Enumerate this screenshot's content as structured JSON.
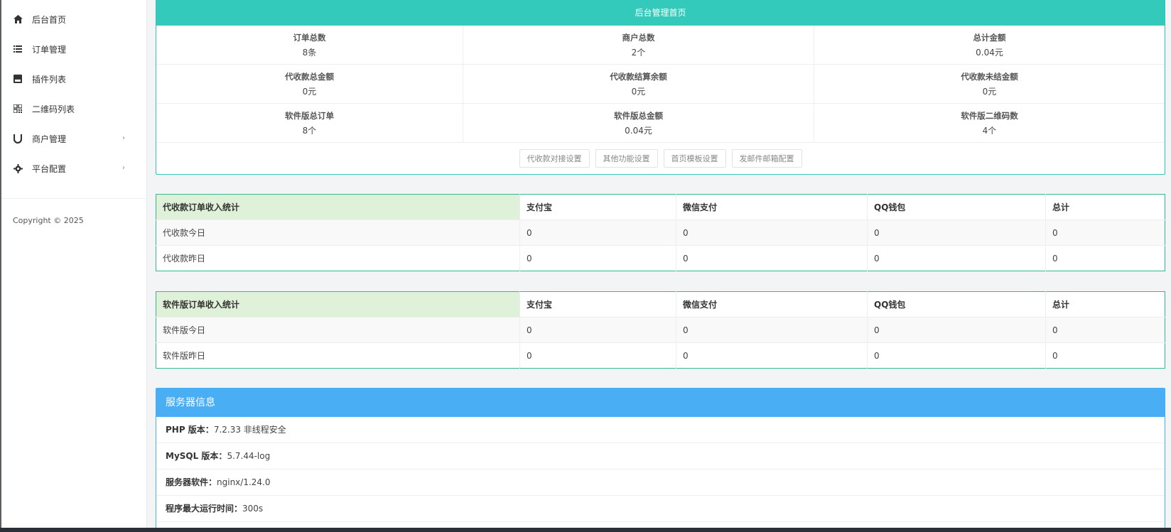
{
  "sidebar": {
    "items": [
      {
        "label": "后台首页",
        "icon": "home-icon"
      },
      {
        "label": "订单管理",
        "icon": "list-icon"
      },
      {
        "label": "插件列表",
        "icon": "plugin-icon"
      },
      {
        "label": "二维码列表",
        "icon": "qrcode-icon"
      },
      {
        "label": "商户管理",
        "icon": "magnet-icon",
        "has_submenu": true
      },
      {
        "label": "平台配置",
        "icon": "gear-icon",
        "has_submenu": true
      }
    ],
    "copyright": "Copyright © 2025"
  },
  "overview": {
    "title": "后台管理首页",
    "stats": [
      {
        "title": "订单总数",
        "value": "8条"
      },
      {
        "title": "商户总数",
        "value": "2个"
      },
      {
        "title": "总计金额",
        "value": "0.04元"
      },
      {
        "title": "代收款总金额",
        "value": "0元"
      },
      {
        "title": "代收款结算余额",
        "value": "0元"
      },
      {
        "title": "代收款未结金额",
        "value": "0元"
      },
      {
        "title": "软件版总订单",
        "value": "8个"
      },
      {
        "title": "软件版总金额",
        "value": "0.04元"
      },
      {
        "title": "软件版二维码数",
        "value": "4个"
      }
    ],
    "buttons": [
      "代收款对接设置",
      "其他功能设置",
      "首页模板设置",
      "发邮件邮箱配置"
    ]
  },
  "collect_table": {
    "headers": [
      "代收款订单收入统计",
      "支付宝",
      "微信支付",
      "QQ钱包",
      "总计"
    ],
    "rows": [
      [
        "代收款今日",
        "0",
        "0",
        "0",
        "0"
      ],
      [
        "代收款昨日",
        "0",
        "0",
        "0",
        "0"
      ]
    ]
  },
  "software_table": {
    "headers": [
      "软件版订单收入统计",
      "支付宝",
      "微信支付",
      "QQ钱包",
      "总计"
    ],
    "rows": [
      [
        "软件版今日",
        "0",
        "0",
        "0",
        "0"
      ],
      [
        "软件版昨日",
        "0",
        "0",
        "0",
        "0"
      ]
    ]
  },
  "server": {
    "title": "服务器信息",
    "rows": [
      {
        "label": "PHP 版本：",
        "value": "7.2.33 非线程安全"
      },
      {
        "label": "MySQL 版本：",
        "value": "5.7.44-log"
      },
      {
        "label": "服务器软件：",
        "value": "nginx/1.24.0"
      },
      {
        "label": "程序最大运行时间：",
        "value": "300s"
      }
    ]
  },
  "colors": {
    "teal_header": "#33c9bb",
    "blue_header": "#4aaef5",
    "green_first_cell": "#dff1d8"
  }
}
